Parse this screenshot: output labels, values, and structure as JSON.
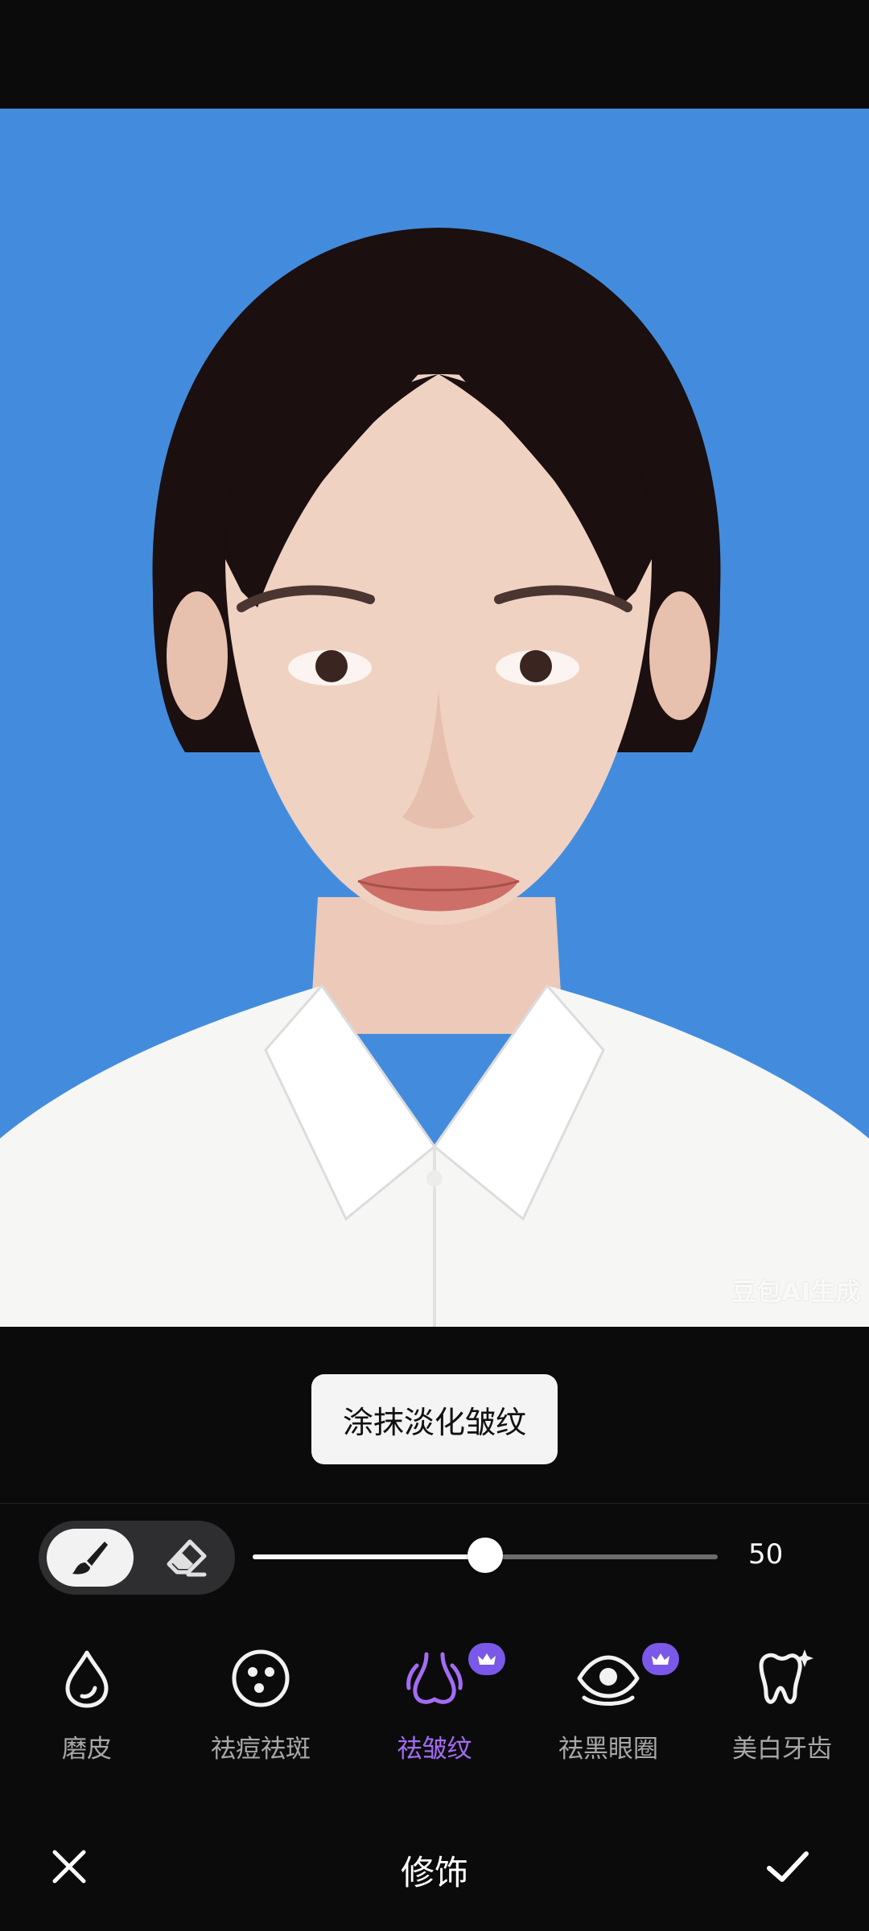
{
  "photo": {
    "watermark": "豆包AI生成",
    "background": "#438cdd"
  },
  "hint": "涂抹淡化皱纹",
  "brush": {
    "mode": "brush",
    "size_value": "50",
    "size_fraction": 0.5
  },
  "tools": [
    {
      "id": "smooth",
      "label": "磨皮",
      "icon": "droplet-icon",
      "vip": false,
      "active": false
    },
    {
      "id": "acne",
      "label": "祛痘祛斑",
      "icon": "spots-face-icon",
      "vip": false,
      "active": false
    },
    {
      "id": "wrinkle",
      "label": "祛皱纹",
      "icon": "nose-lines-icon",
      "vip": true,
      "active": true
    },
    {
      "id": "dark-circles",
      "label": "祛黑眼圈",
      "icon": "eye-icon",
      "vip": true,
      "active": false
    },
    {
      "id": "teeth",
      "label": "美白牙齿",
      "icon": "tooth-sparkle-icon",
      "vip": false,
      "active": false
    }
  ],
  "bottom": {
    "title": "修饰"
  },
  "colors": {
    "accent": "#a46cf2",
    "vip": "#7a58e8"
  }
}
